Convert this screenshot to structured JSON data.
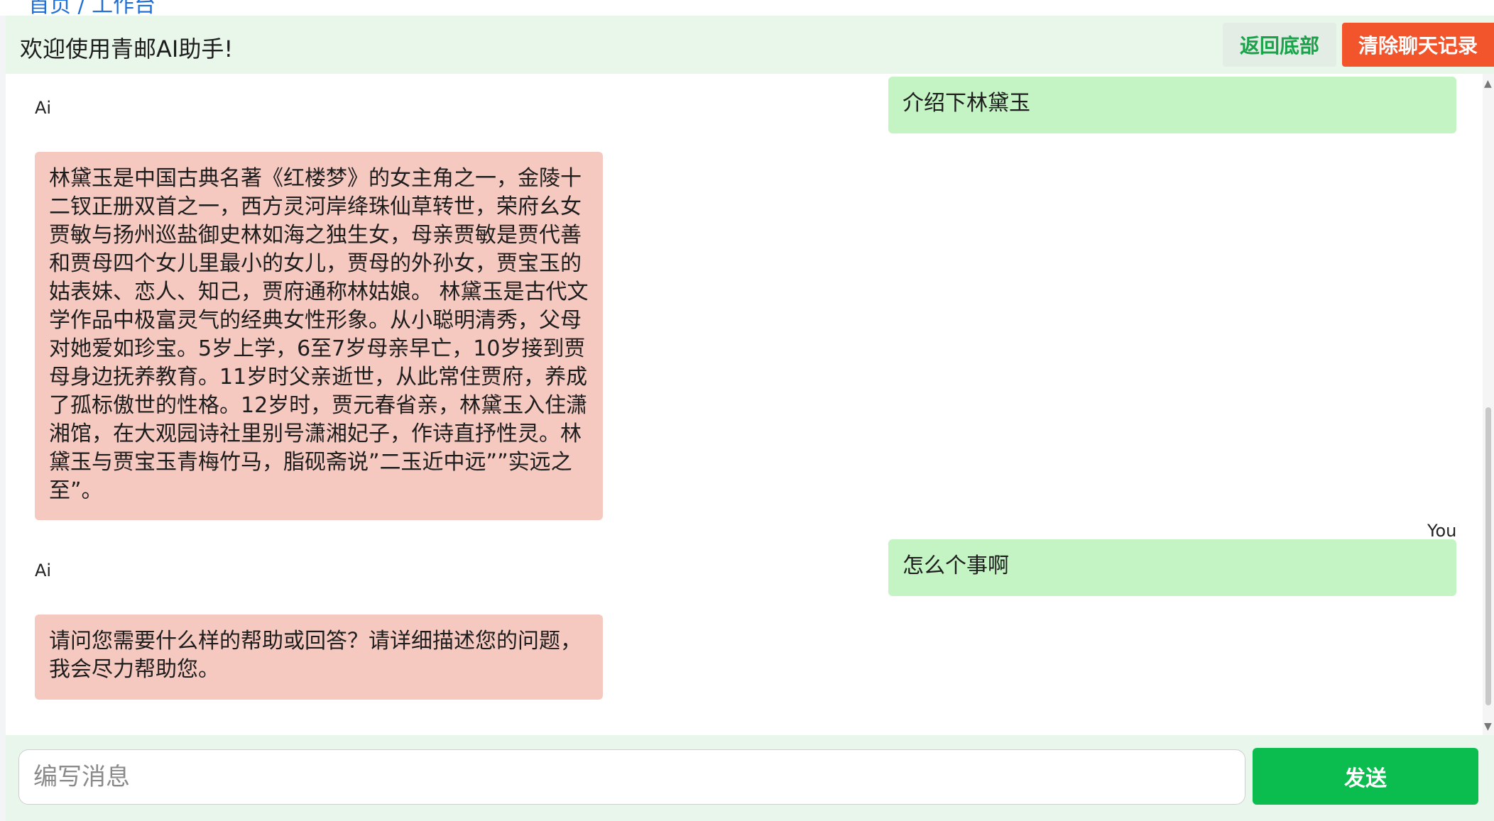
{
  "breadcrumb": {
    "text": "首页 / 工作台"
  },
  "header": {
    "welcome": "欢迎使用青邮AI助手!",
    "back_to_bottom": "返回底部",
    "clear_history": "清除聊天记录"
  },
  "messages": [
    {
      "role": "user",
      "sender": "You",
      "text": "介绍下林黛玉"
    },
    {
      "role": "ai",
      "sender": "Ai",
      "text": "林黛玉是中国古典名著《红楼梦》的女主角之一，金陵十二钗正册双首之一，西方灵河岸绛珠仙草转世，荣府幺女贾敏与扬州巡盐御史林如海之独生女，母亲贾敏是贾代善和贾母四个女儿里最小的女儿，贾母的外孙女，贾宝玉的姑表妹、恋人、知己，贾府通称林姑娘。 林黛玉是古代文学作品中极富灵气的经典女性形象。从小聪明清秀，父母对她爱如珍宝。5岁上学，6至7岁母亲早亡，10岁接到贾母身边抚养教育。11岁时父亲逝世，从此常住贾府，养成了孤标傲世的性格。12岁时，贾元春省亲，林黛玉入住潇湘馆，在大观园诗社里别号潇湘妃子，作诗直抒性灵。林黛玉与贾宝玉青梅竹马，脂砚斋说”二玉近中远””实远之至”。"
    },
    {
      "role": "user",
      "sender": "You",
      "text": "怎么个事啊"
    },
    {
      "role": "ai",
      "sender": "Ai",
      "text": "请问您需要什么样的帮助或回答？请详细描述您的问题，我会尽力帮助您。"
    }
  ],
  "composer": {
    "placeholder": "编写消息",
    "send_label": "发送"
  },
  "colors": {
    "header_bg": "#e8f7ea",
    "accent_green": "#0bbd4f",
    "clear_red": "#f2552c",
    "user_bubble": "#c4f3c4",
    "ai_bubble": "#f5c8c0"
  }
}
